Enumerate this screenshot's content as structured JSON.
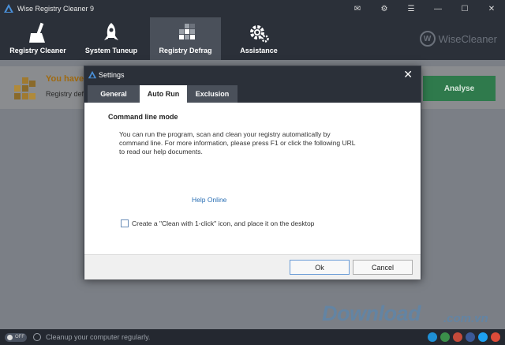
{
  "app": {
    "title": "Wise Registry Cleaner 9"
  },
  "window_controls": [
    "mail-icon",
    "settings-icon",
    "menu-icon",
    "minimize-icon",
    "maximize-icon",
    "close-icon"
  ],
  "toolbar": {
    "items": [
      {
        "label": "Registry Cleaner",
        "icon": "broom-icon"
      },
      {
        "label": "System Tuneup",
        "icon": "rocket-icon"
      },
      {
        "label": "Registry Defrag",
        "icon": "blocks-icon",
        "active": true
      },
      {
        "label": "Assistance",
        "icon": "gear-icon"
      }
    ],
    "brand": "WiseCleaner",
    "brand_letter": "W"
  },
  "banner": {
    "title": "You haven",
    "subtitle": "Registry defr",
    "analyse_label": "Analyse"
  },
  "dialog": {
    "title": "Settings",
    "close": "✕",
    "tabs": [
      "General",
      "Auto Run",
      "Exclusion"
    ],
    "active_tab": "Auto Run",
    "section_title": "Command line mode",
    "description": "You can run the program, scan and clean your registry automatically by command line. For more information, please press F1 or click the following URL to read our help documents.",
    "help_link": "Help Online",
    "checkbox_label": "Create a \"Clean with 1-click\" icon, and place it on the desktop",
    "checkbox_checked": false,
    "ok_label": "Ok",
    "cancel_label": "Cancel"
  },
  "statusbar": {
    "toggle_label": "OFF",
    "text": "Cleanup your computer regularly."
  },
  "watermark": {
    "main": "Download",
    "sub": ".com.vn"
  },
  "colors": {
    "accent": "#2f7a4c",
    "link": "#2a6fb4",
    "dark": "#2b3039"
  }
}
